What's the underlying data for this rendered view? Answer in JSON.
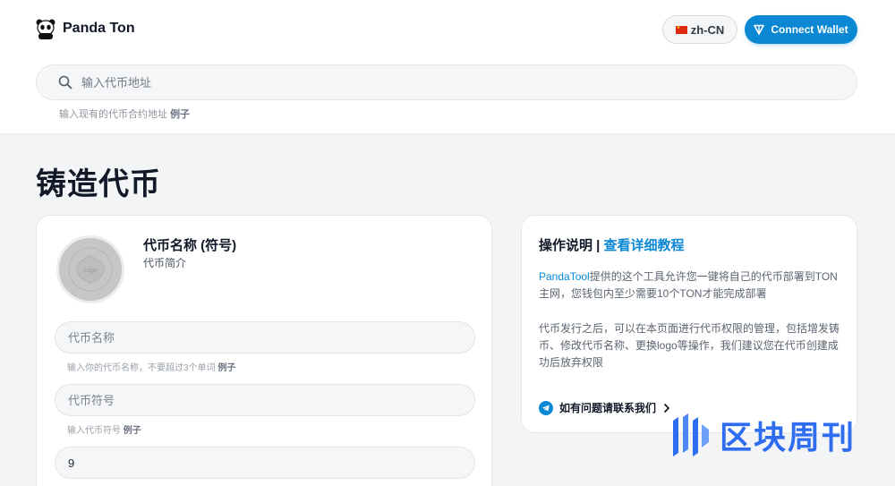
{
  "brand": {
    "name": "Panda Ton",
    "logo_icon": "panda-icon"
  },
  "header": {
    "language": "zh-CN",
    "language_flag": "flag-cn-icon",
    "connect_wallet": "Connect Wallet",
    "wallet_icon": "ton-icon",
    "accent_color": "#0a88d4"
  },
  "search": {
    "placeholder": "输入代币地址",
    "hint": "输入现有的代币合约地址",
    "example": "例子"
  },
  "page": {
    "title": "铸造代币"
  },
  "form": {
    "logo_label": "Logo",
    "token_title": "代币名称 (符号)",
    "token_desc": "代币简介",
    "name_placeholder": "代币名称",
    "name_hint": "输入你的代币名称，不要超过3个单词",
    "symbol_placeholder": "代币符号",
    "symbol_hint": "输入代币符号",
    "example": "例子",
    "decimals_value": "9"
  },
  "info": {
    "title": "操作说明 |",
    "tutorial_link": "查看详细教程",
    "p1_brand": "PandaTool",
    "p1_text": "提供的这个工具允许您一键将自己的代币部署到TON主网，您钱包内至少需要10个TON才能完成部署",
    "p2_text": "代币发行之后，可以在本页面进行代币权限的管理，包括增发铸币、修改代币名称、更换logo等操作，我们建议您在代币创建成功后放弃权限",
    "contact": "如有问题请联系我们",
    "contact_icon": "telegram-icon"
  },
  "watermark": {
    "text": "区块周刊",
    "color": "#2f6df0"
  }
}
